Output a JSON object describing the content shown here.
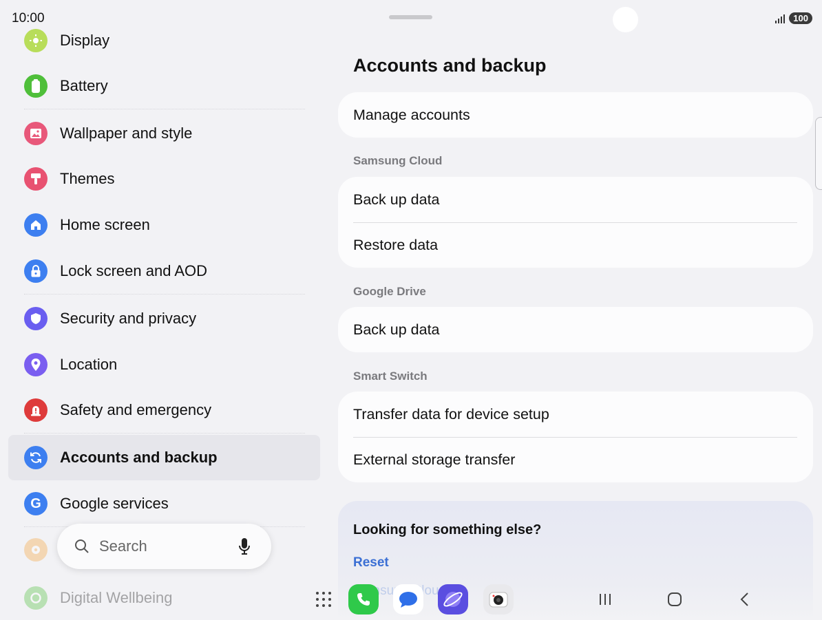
{
  "status_bar": {
    "time": "10:00",
    "battery": "100"
  },
  "sidebar": {
    "items": [
      {
        "label": "Display",
        "icon": "sun-icon",
        "color": "#9bd34a"
      },
      {
        "label": "Battery",
        "icon": "battery-icon",
        "color": "#4fbf3a"
      },
      {
        "label": "Wallpaper and style",
        "icon": "image-icon",
        "color": "#e8587a"
      },
      {
        "label": "Themes",
        "icon": "brush-icon",
        "color": "#e85271"
      },
      {
        "label": "Home screen",
        "icon": "home-icon",
        "color": "#3d7ff0"
      },
      {
        "label": "Lock screen and AOD",
        "icon": "lock-icon",
        "color": "#3d7ff0"
      },
      {
        "label": "Security and privacy",
        "icon": "shield-icon",
        "color": "#6a5ef0"
      },
      {
        "label": "Location",
        "icon": "location-pin-icon",
        "color": "#7a5ef0"
      },
      {
        "label": "Safety and emergency",
        "icon": "alert-icon",
        "color": "#de3b3b"
      },
      {
        "label": "Accounts and backup",
        "icon": "sync-icon",
        "color": "#3d7ff0"
      },
      {
        "label": "Google services",
        "icon": "google-icon",
        "color": "#3d7ff0"
      },
      {
        "label": "",
        "icon": "gear-icon",
        "color": "#f5a33a"
      },
      {
        "label": "Digital Wellbeing",
        "icon": "wellbeing-icon",
        "color": "#4fbf3a"
      }
    ]
  },
  "search": {
    "placeholder": "Search"
  },
  "main": {
    "title": "Accounts and backup",
    "manage_accounts": "Manage accounts",
    "sections": [
      {
        "label": "Samsung Cloud",
        "rows": [
          "Back up data",
          "Restore data"
        ]
      },
      {
        "label": "Google Drive",
        "rows": [
          "Back up data"
        ]
      },
      {
        "label": "Smart Switch",
        "rows": [
          "Transfer data for device setup",
          "External storage transfer"
        ]
      }
    ],
    "looking": {
      "title": "Looking for something else?",
      "link1": "Reset",
      "link2": "Samsung Cloud"
    }
  }
}
